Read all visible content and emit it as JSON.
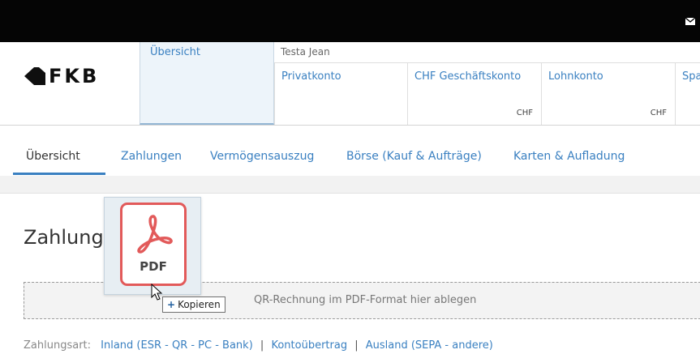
{
  "colors": {
    "accent": "#3a80c1",
    "topbar": "#050505",
    "pdf_red": "#e25a5a"
  },
  "logo": {
    "text": "FKB"
  },
  "header": {
    "overview": "Übersicht",
    "owner": "Testa Jean",
    "accounts": [
      {
        "name": "Privatkonto",
        "currency": ""
      },
      {
        "name": "CHF Geschäftskonto",
        "currency": "CHF"
      },
      {
        "name": "Lohnkonto",
        "currency": "CHF"
      },
      {
        "name": "Spa",
        "currency": ""
      }
    ]
  },
  "tabs": [
    {
      "label": "Übersicht",
      "active": true
    },
    {
      "label": "Zahlungen",
      "active": false
    },
    {
      "label": "Vermögensauszug",
      "active": false
    },
    {
      "label": "Börse (Kauf & Aufträge)",
      "active": false
    },
    {
      "label": "Karten & Aufladung",
      "active": false
    }
  ],
  "main": {
    "title": "Zahlung",
    "dropzone_hint": "QR-Rechnung im PDF-Format hier ablegen",
    "drag_icon": {
      "icon": "pdf-file-icon",
      "label": "PDF"
    },
    "copy_tooltip": "Kopieren",
    "copy_plus": "+",
    "payment_types": {
      "label": "Zahlungsart:",
      "options": [
        "Inland (ESR - QR - PC - Bank)",
        "Kontoübertrag",
        "Ausland (SEPA - andere)"
      ],
      "separator": "|"
    }
  }
}
